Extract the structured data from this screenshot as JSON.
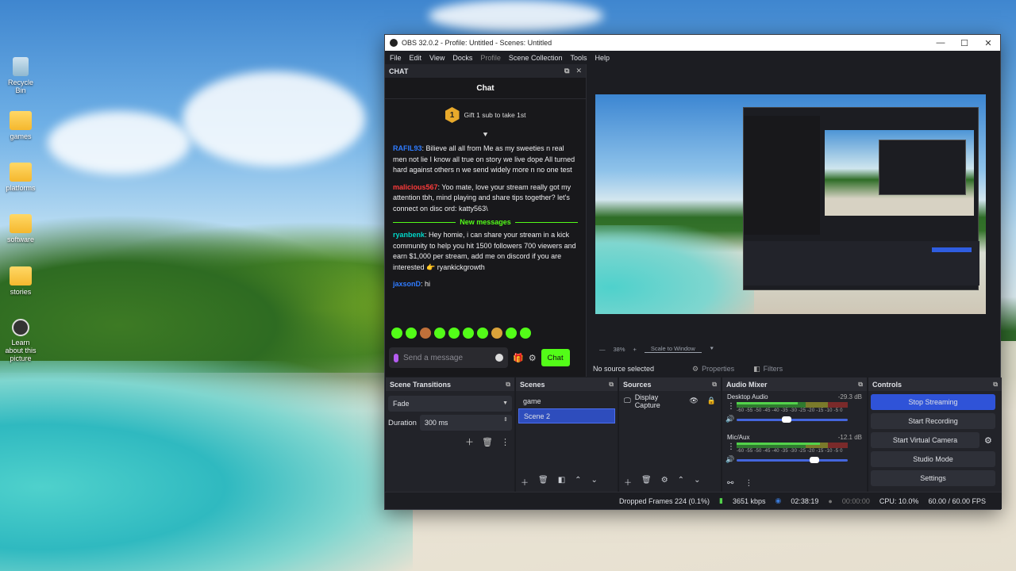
{
  "desktop": {
    "icons": [
      {
        "label": "Recycle Bin"
      },
      {
        "label": "games"
      },
      {
        "label": "platforms"
      },
      {
        "label": "software"
      },
      {
        "label": "stories"
      },
      {
        "label": "Learn about this picture"
      }
    ]
  },
  "window": {
    "title": "OBS 32.0.2 - Profile: Untitled - Scenes: Untitled",
    "controls": {
      "minimize": "—",
      "maximize": "☐",
      "close": "✕"
    }
  },
  "menu": [
    "File",
    "Edit",
    "View",
    "Docks",
    "Profile",
    "Scene Collection",
    "Tools",
    "Help"
  ],
  "chat_dock": {
    "header": "CHAT",
    "title": "Chat",
    "gift": {
      "badge": "1",
      "text": "Gift 1 sub to take 1st"
    },
    "messages": [
      {
        "user": "RAFIL93",
        "color": "#2f7bff",
        "text": "Bilieve all all from Me as my sweeties n real men not lie I know all true on story we live dope All turned hard against others n we send widely more n no one test"
      },
      {
        "user": "malicious567",
        "color": "#ff3b3b",
        "text": "Yoo mate, love your stream really got my attention tbh, mind playing and share tips together? let's connect on disc ord: katty563\\"
      }
    ],
    "new_messages_label": "New messages",
    "new_messages": [
      {
        "user": "ryanbenk",
        "color": "#00d7c8",
        "text": "Hey homie, i can share your stream in a kick community to help you hit 1500 followers 700 viewers and earn $1,000 per stream, add me on discord if you are interested 👉 ryankickgrowth"
      },
      {
        "user": "jaxsonD",
        "color": "#2f7bff",
        "text": "hi"
      }
    ],
    "input_placeholder": "Send a message",
    "send_label": "Chat"
  },
  "preview": {
    "zoom": "38%",
    "scale_mode": "Scale to Window",
    "no_source": "No source selected",
    "properties_label": "Properties",
    "filters_label": "Filters"
  },
  "scene_transitions": {
    "title": "Scene Transitions",
    "transition": "Fade",
    "duration_label": "Duration",
    "duration_value": "300 ms"
  },
  "scenes": {
    "title": "Scenes",
    "items": [
      "game",
      "Scene 2"
    ],
    "selected": "Scene 2"
  },
  "sources": {
    "title": "Sources",
    "items": [
      "Display Capture"
    ]
  },
  "audio_mixer": {
    "title": "Audio Mixer",
    "channels": [
      {
        "name": "Desktop Audio",
        "db": "-29.3 dB",
        "level": 0.55,
        "volume": 0.45
      },
      {
        "name": "Mic/Aux",
        "db": "-12.1 dB",
        "level": 0.75,
        "volume": 0.7
      }
    ],
    "ticks": "-60 -55 -50 -45 -40 -35 -30 -25 -20 -15 -10 -5 0"
  },
  "controls": {
    "title": "Controls",
    "buttons": [
      "Stop Streaming",
      "Start Recording",
      "Start Virtual Camera",
      "Studio Mode",
      "Settings"
    ]
  },
  "status": {
    "dropped": "Dropped Frames 224 (0.1%)",
    "bitrate": "3651 kbps",
    "stream_time": "02:38:19",
    "rec_time": "00:00:00",
    "cpu": "CPU: 10.0%",
    "fps": "60.00 / 60.00 FPS"
  }
}
